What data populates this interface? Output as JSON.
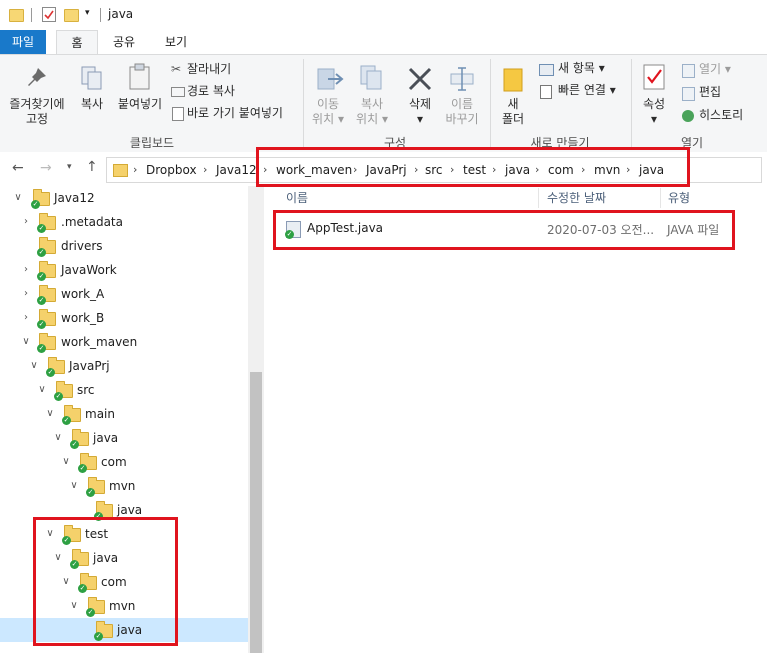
{
  "window": {
    "title": "java"
  },
  "ribbon_tabs": [
    "파일",
    "홈",
    "공유",
    "보기"
  ],
  "ribbon": {
    "pin_label_1": "즐겨찾기에",
    "pin_label_2": "고정",
    "copy_label": "복사",
    "paste_label": "붙여넣기",
    "cut_label": "잘라내기",
    "copy_path_label": "경로 복사",
    "paste_shortcut_label": "바로 가기 붙여넣기",
    "clipboard_group": "클립보드",
    "move_label_1": "이동",
    "move_label_2": "위치",
    "copyto_label_1": "복사",
    "copyto_label_2": "위치",
    "delete_label": "삭제",
    "rename_label_1": "이름",
    "rename_label_2": "바꾸기",
    "organize_group": "구성",
    "newfolder_label_1": "새",
    "newfolder_label_2": "폴더",
    "new_item_label": "새 항목",
    "easy_access_label": "빠른 연결",
    "new_group": "새로 만들기",
    "properties_label": "속성",
    "open_label": "열기",
    "edit_label": "편집",
    "history_label": "히스토리",
    "open_group": "열기"
  },
  "address": {
    "crumbs": [
      "Dropbox",
      "Java12",
      "work_maven",
      "JavaPrj",
      "src",
      "test",
      "java",
      "com",
      "mvn",
      "java"
    ]
  },
  "tree": [
    {
      "label": "Java12"
    },
    {
      "label": ".metadata"
    },
    {
      "label": "drivers"
    },
    {
      "label": "JavaWork"
    },
    {
      "label": "work_A"
    },
    {
      "label": "work_B"
    },
    {
      "label": "work_maven"
    },
    {
      "label": "JavaPrj"
    },
    {
      "label": "src"
    },
    {
      "label": "main"
    },
    {
      "label": "java"
    },
    {
      "label": "com"
    },
    {
      "label": "mvn"
    },
    {
      "label": "java"
    },
    {
      "label": "test"
    },
    {
      "label": "java"
    },
    {
      "label": "com"
    },
    {
      "label": "mvn"
    },
    {
      "label": "java"
    }
  ],
  "file_list": {
    "columns": [
      "이름",
      "수정한 날짜",
      "유형"
    ],
    "rows": [
      {
        "name": "AppTest.java",
        "modified": "2020-07-03 오전...",
        "type": "JAVA 파일"
      }
    ]
  },
  "colors": {
    "accent": "#1979ca",
    "highlight_box": "#e0141e",
    "selection": "#cce8ff"
  }
}
